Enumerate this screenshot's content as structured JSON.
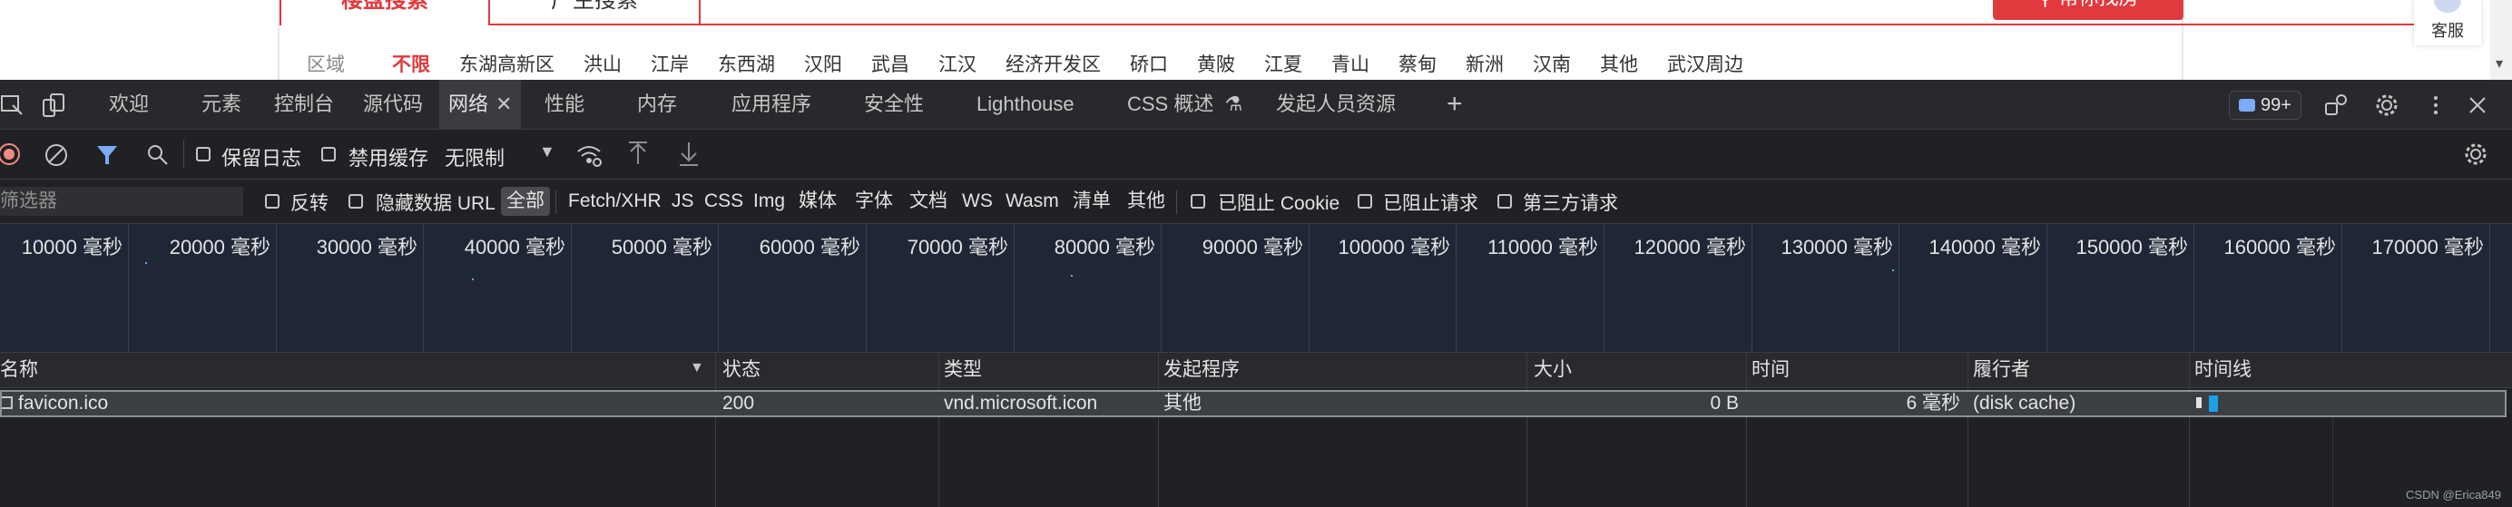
{
  "page": {
    "search_tab_active": "楼盘搜索",
    "search_tab_inactive": "广生搜索",
    "red_button_label": "帮你找房",
    "area_label": "区域",
    "areas": [
      "不限",
      "东湖高新区",
      "洪山",
      "江岸",
      "东西湖",
      "汉阳",
      "武昌",
      "江汉",
      "经济开发区",
      "硚口",
      "黄陂",
      "江夏",
      "青山",
      "蔡甸",
      "新洲",
      "汉南",
      "其他",
      "武汉周边"
    ],
    "selected_area_index": 0,
    "kefu_label": "客服"
  },
  "devtools": {
    "tabs": [
      "欢迎",
      "元素",
      "控制台",
      "源代码",
      "网络",
      "性能",
      "内存",
      "应用程序",
      "安全性",
      "Lighthouse",
      "CSS 概述",
      "发起人员资源"
    ],
    "active_tab_index": 4,
    "message_count": "99+",
    "toolbar": {
      "preserve_log": "保留日志",
      "disable_cache": "禁用缓存",
      "throttle": "无限制"
    },
    "filter": {
      "placeholder": "筛选器",
      "invert": "反转",
      "hide_data_urls": "隐藏数据 URL",
      "types": [
        "全部",
        "Fetch/XHR",
        "JS",
        "CSS",
        "Img",
        "媒体",
        "字体",
        "文档",
        "WS",
        "Wasm",
        "清单",
        "其他"
      ],
      "selected_type_index": 0,
      "blocked_cookies": "已阻止 Cookie",
      "blocked_requests": "已阻止请求",
      "third_party": "第三方请求"
    },
    "overview_ticks": [
      "10000 毫秒",
      "20000 毫秒",
      "30000 毫秒",
      "40000 毫秒",
      "50000 毫秒",
      "60000 毫秒",
      "70000 毫秒",
      "80000 毫秒",
      "90000 毫秒",
      "100000 毫秒",
      "110000 毫秒",
      "120000 毫秒",
      "130000 毫秒",
      "140000 毫秒",
      "150000 毫秒",
      "160000 毫秒",
      "170000 毫秒"
    ],
    "columns": {
      "name": "名称",
      "status": "状态",
      "type": "类型",
      "initiator": "发起程序",
      "size": "大小",
      "time": "时间",
      "fulfilled_by": "履行者",
      "waterfall": "时间线"
    },
    "requests": [
      {
        "name": "favicon.ico",
        "status": "200",
        "type": "vnd.microsoft.icon",
        "initiator": "其他",
        "size": "0 B",
        "time": "6 毫秒",
        "fulfilled_by": "(disk cache)"
      }
    ],
    "watermark": "CSDN @Erica849"
  },
  "colors": {
    "brand_red": "#e03a3e",
    "devtools_bg": "#202124",
    "accent_blue": "#7cacf8",
    "record_red": "#f28b82"
  }
}
